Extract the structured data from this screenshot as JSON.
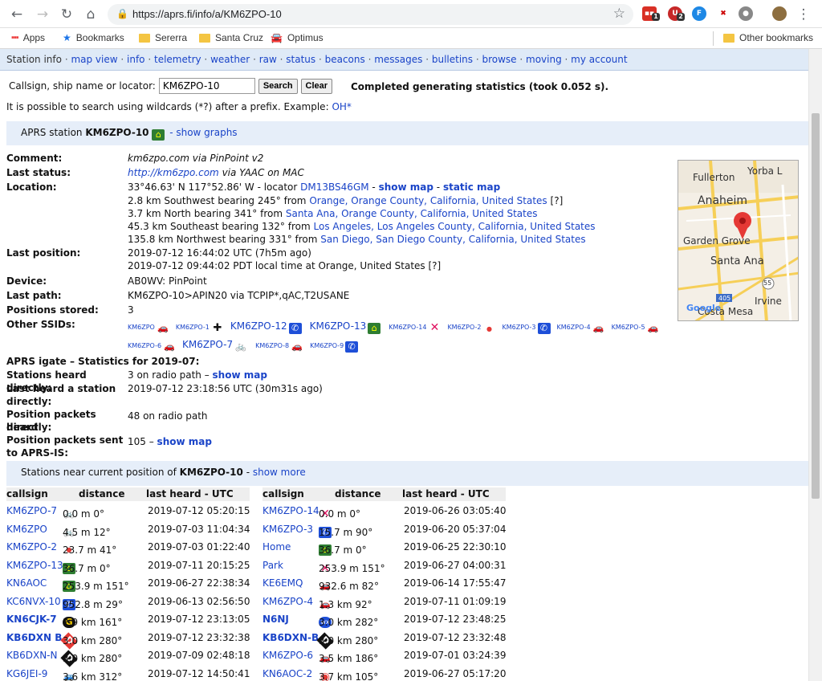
{
  "browser": {
    "url": "https://aprs.fi/info/a/KM6ZPO-10",
    "bookmarks": [
      "Apps",
      "Bookmarks",
      "Sererra",
      "Santa Cruz",
      "Optimus"
    ],
    "other_bookmarks": "Other bookmarks",
    "ext_badges": [
      "1",
      "2"
    ]
  },
  "nav": {
    "current": "Station info",
    "links": [
      "map view",
      "info",
      "telemetry",
      "weather",
      "raw",
      "status",
      "beacons",
      "messages",
      "bulletins",
      "browse",
      "moving",
      "my account"
    ]
  },
  "search": {
    "label": "Callsign, ship name or locator:",
    "value": "KM6ZPO-10",
    "search_btn": "Search",
    "clear_btn": "Clear",
    "status": "Completed generating statistics (took 0.052 s).",
    "hint": "It is possible to search using wildcards (*?) after a prefix. Example:",
    "hint_example": "OH*"
  },
  "station": {
    "header_prefix": "APRS station",
    "callsign": "KM6ZPO-10",
    "show_graphs": "- show graphs",
    "comment_label": "Comment:",
    "comment": "km6zpo.com via PinPoint v2",
    "last_status_label": "Last status:",
    "last_status_link": "http://km6zpo.com",
    "last_status_rest": "via YAAC on MAC",
    "location_label": "Location:",
    "location_coords": "33°46.63' N 117°52.86' W - locator",
    "locator": "DM13BS46GM",
    "show_map": "show map",
    "static_map": "static map",
    "loc_lines": [
      {
        "pre": "2.8 km Southwest bearing 245° from",
        "link": "Orange, Orange County, California, United States",
        "post": "[?]"
      },
      {
        "pre": "3.7 km North bearing 341° from",
        "link": "Santa Ana, Orange County, California, United States",
        "post": ""
      },
      {
        "pre": "45.3 km Southeast bearing 132° from",
        "link": "Los Angeles, Los Angeles County, California, United States",
        "post": ""
      },
      {
        "pre": "135.8 km Northwest bearing 331° from",
        "link": "San Diego, San Diego County, California, United States",
        "post": ""
      }
    ],
    "last_position_label": "Last position:",
    "last_position_1": "2019-07-12 16:44:02 UTC (7h5m ago)",
    "last_position_2": "2019-07-12 09:44:02 PDT local time at Orange, United States [?]",
    "device_label": "Device:",
    "device": "AB0WV: PinPoint",
    "last_path_label": "Last path:",
    "last_path": "KM6ZPO-10>APIN20 via TCPIP*,qAC,T2USANE",
    "positions_label": "Positions stored:",
    "positions": "3",
    "ssids_label": "Other SSIDs:",
    "ssids_row1": [
      {
        "name": "KM6ZPO",
        "icon": "car-icon",
        "big": false
      },
      {
        "name": "KM6ZPO-1",
        "icon": "cross-icon",
        "big": false
      },
      {
        "name": "KM6ZPO-12",
        "icon": "phone-icon",
        "big": true
      },
      {
        "name": "KM6ZPO-13",
        "icon": "house-icon",
        "big": true
      },
      {
        "name": "KM6ZPO-14",
        "icon": "x-icon",
        "big": false
      },
      {
        "name": "KM6ZPO-2",
        "icon": "dot-icon",
        "big": false
      },
      {
        "name": "KM6ZPO-3",
        "icon": "phone-icon",
        "big": false
      },
      {
        "name": "KM6ZPO-4",
        "icon": "car-icon",
        "big": false
      },
      {
        "name": "KM6ZPO-5",
        "icon": "car-icon",
        "big": false
      }
    ],
    "ssids_row2": [
      {
        "name": "KM6ZPO-6",
        "icon": "car-icon",
        "big": false
      },
      {
        "name": "KM6ZPO-7",
        "icon": "bike-icon",
        "big": true
      },
      {
        "name": "KM6ZPO-8",
        "icon": "car-icon",
        "big": false
      },
      {
        "name": "KM6ZPO-9",
        "icon": "phone-icon",
        "big": false
      }
    ]
  },
  "igate": {
    "title": "APRS igate – Statistics for 2019-07:",
    "heard_label": "Stations heard directly:",
    "heard_value": "3 on radio path –",
    "heard_link": "show map",
    "last_heard_label_1": "Last heard a station",
    "last_heard_label_2": "directly:",
    "last_heard_value": "2019-07-12 23:18:56 UTC (30m31s ago)",
    "pos_heard_label_1": "Position packets heard",
    "pos_heard_label_2": "directly:",
    "pos_heard_value": "48 on radio path",
    "pos_sent_label_1": "Position packets sent",
    "pos_sent_label_2": "to APRS-IS:",
    "pos_sent_value": "105 –",
    "pos_sent_link": "show map"
  },
  "near": {
    "prefix": "Stations near current position of",
    "callsign": "KM6ZPO-10",
    "show_more": "show more",
    "headers": [
      "callsign",
      "distance",
      "last heard - UTC"
    ],
    "left": [
      {
        "call": "KM6ZPO-7",
        "icon": "bike-icon",
        "dist": "0.0 m 0°",
        "time": "2019-07-12 05:20:15",
        "bold": false
      },
      {
        "call": "KM6ZPO",
        "icon": "bike-icon",
        "dist": "4.5 m 12°",
        "time": "2019-07-03 11:04:34",
        "bold": false
      },
      {
        "call": "KM6ZPO-2",
        "icon": "dot-icon",
        "dist": "23.7 m 41°",
        "time": "2019-07-03 01:22:40",
        "bold": false
      },
      {
        "call": "KM6ZPO-13",
        "icon": "house-icon",
        "dist": "36.7 m 0°",
        "time": "2019-07-11 20:15:25",
        "bold": false
      },
      {
        "call": "KN6AOC",
        "icon": "house-icon",
        "dist": "253.9 m 151°",
        "time": "2019-06-27 22:38:34",
        "bold": false
      },
      {
        "call": "KC6NVX-10",
        "icon": "phone-icon",
        "dist": "952.8 m 29°",
        "time": "2019-06-13 02:56:50",
        "bold": false
      },
      {
        "call": "KN6CJK-7",
        "icon": "g-icon",
        "dist": "2.9 km 161°",
        "time": "2019-07-12 23:13:05",
        "bold": true
      },
      {
        "call": "KB6DXN B",
        "icon": "d-red-icon",
        "dist": "3.0 km 280°",
        "time": "2019-07-12 23:32:38",
        "bold": true
      },
      {
        "call": "KB6DXN-N",
        "icon": "d-black-icon",
        "dist": "3.0 km 280°",
        "time": "2019-07-09 02:48:18",
        "bold": false
      },
      {
        "call": "KG6JEI-9",
        "icon": "truck-icon",
        "dist": "3.6 km 312°",
        "time": "2019-07-12 14:50:41",
        "bold": false
      }
    ],
    "right": [
      {
        "call": "KM6ZPO-14",
        "icon": "x-icon",
        "dist": "0.0 m 0°",
        "time": "2019-06-26 03:05:40",
        "bold": false
      },
      {
        "call": "KM6ZPO-3",
        "icon": "phone-icon",
        "dist": "15.7 m 90°",
        "time": "2019-06-20 05:37:04",
        "bold": false
      },
      {
        "call": "Home",
        "icon": "house-icon",
        "dist": "36.7 m 0°",
        "time": "2019-06-25 22:30:10",
        "bold": false
      },
      {
        "call": "Park",
        "icon": "x-icon",
        "dist": "253.9 m 151°",
        "time": "2019-06-27 04:00:31",
        "bold": false
      },
      {
        "call": "KE6EMQ",
        "icon": "car-icon",
        "dist": "932.6 m 82°",
        "time": "2019-06-14 17:55:47",
        "bold": false
      },
      {
        "call": "KM6ZPO-4",
        "icon": "car-icon",
        "dist": "1.3 km 92°",
        "time": "2019-07-11 01:09:19",
        "bold": false
      },
      {
        "call": "N6NJ",
        "icon": "wx-icon",
        "dist": "3.0 km 282°",
        "time": "2019-07-12 23:48:25",
        "bold": true
      },
      {
        "call": "KB6DXN-B",
        "icon": "d-black-icon",
        "dist": "3.0 km 280°",
        "time": "2019-07-12 23:32:48",
        "bold": true
      },
      {
        "call": "KM6ZPO-6",
        "icon": "car-icon",
        "dist": "3.5 km 186°",
        "time": "2019-07-01 03:24:39",
        "bold": false
      },
      {
        "call": "KN6AOC-2",
        "icon": "target-icon",
        "dist": "3.7 km 105°",
        "time": "2019-06-27 05:17:20",
        "bold": false
      }
    ]
  },
  "map": {
    "labels": [
      "Fullerton",
      "Yorba L",
      "Anaheim",
      "Garden Grove",
      "Santa Ana",
      "Irvine",
      "Costa Mesa",
      "55",
      "405"
    ],
    "google": "Google"
  },
  "colors": {
    "link": "#1a44c8",
    "nav_bg": "#dfeaf7",
    "section_bg": "#e6eef9"
  }
}
